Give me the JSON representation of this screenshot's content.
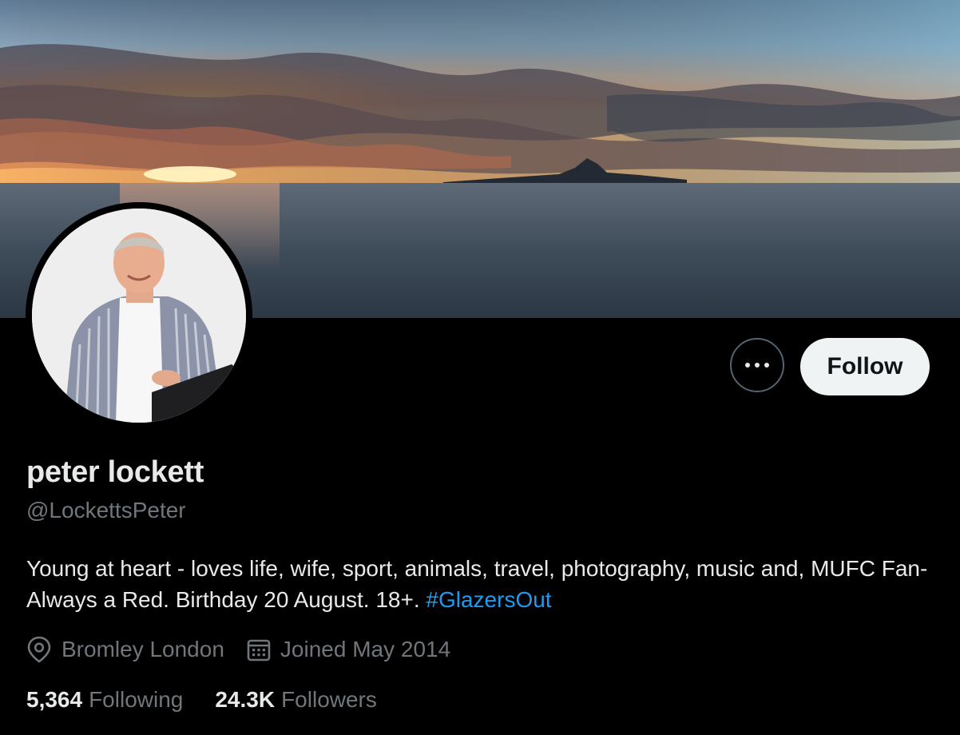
{
  "profile": {
    "display_name": "peter lockett",
    "handle": "@LockettsPeter",
    "bio_text": "Young at heart - loves life, wife, sport, animals, travel, photography, music and, MUFC Fan-Always a Red. Birthday 20 August. 18+. ",
    "bio_hashtag": "#GlazersOut",
    "location": "Bromley London",
    "joined": "Joined May 2014"
  },
  "actions": {
    "more_icon": "more-horizontal-icon",
    "follow_label": "Follow"
  },
  "stats": {
    "following_count": "5,364",
    "following_label": "Following",
    "followers_count": "24.3K",
    "followers_label": "Followers"
  },
  "icons": {
    "location": "location-pin-icon",
    "calendar": "calendar-icon"
  },
  "colors": {
    "background": "#000000",
    "text_primary": "#e7e9ea",
    "text_secondary": "#71767b",
    "link": "#1d9bf0",
    "follow_button_bg": "#eff3f4",
    "border": "#536471"
  }
}
